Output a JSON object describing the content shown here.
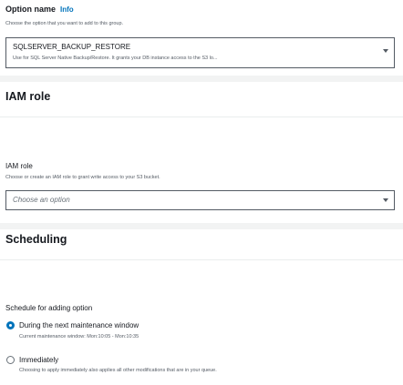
{
  "option_name": {
    "label": "Option name",
    "info": "Info",
    "description": "Choose the option that you want to add to this group.",
    "selected_value": "SQLSERVER_BACKUP_RESTORE",
    "selected_description": "Use for SQL Server Native Backup/Restore. It grants your DB instance access to the S3 lo..."
  },
  "iam_section": {
    "title": "IAM role",
    "field_label": "IAM role",
    "description": "Choose or create an IAM role to grant write access to your S3 bucket.",
    "placeholder": "Choose an option"
  },
  "scheduling": {
    "title": "Scheduling",
    "field_label": "Schedule for adding option",
    "options": [
      {
        "label": "During the next maintenance window",
        "description": "Current maintenance window: Mon:10:05 - Mon:10:35",
        "selected": true
      },
      {
        "label": "Immediately",
        "description": "Choosing to apply immediately also applies all other modifications that are in your queue.",
        "selected": false
      }
    ]
  },
  "colors": {
    "link": "#0073bb",
    "radio_selected": "#0073bb",
    "page_background": "#f2f3f3"
  }
}
